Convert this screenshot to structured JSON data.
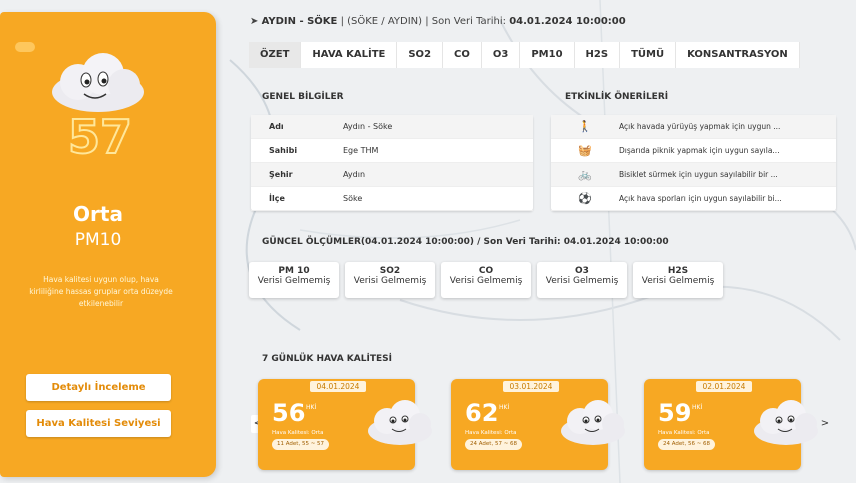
{
  "header": {
    "location": "AYDIN - SÖKE",
    "sub": "(SÖKE / AYDIN)",
    "last_label": "Son Veri Tarihi:",
    "last_value": "04.01.2024 10:00:00"
  },
  "tabs": [
    "ÖZET",
    "HAVA KALİTE",
    "SO2",
    "CO",
    "O3",
    "PM10",
    "H2S",
    "TÜMÜ",
    "KONSANTRASYON"
  ],
  "left": {
    "aqi": "57",
    "category": "Orta",
    "pollutant": "PM10",
    "description": "Hava kalitesi uygun olup, hava kirliliğine hassas gruplar orta düzeyde etkilenebilir",
    "btn_detail": "Detaylı İnceleme",
    "btn_level": "Hava Kalitesi Seviyesi",
    "accent": "#f7a823"
  },
  "general": {
    "title": "GENEL BİLGİLER",
    "rows": [
      {
        "k": "Adı",
        "v": "Aydın - Söke"
      },
      {
        "k": "Sahibi",
        "v": "Ege THM"
      },
      {
        "k": "Şehir",
        "v": "Aydın"
      },
      {
        "k": "İlçe",
        "v": "Söke"
      }
    ]
  },
  "activities": {
    "title": "ETKİNLİK ÖNERİLERİ",
    "rows": [
      {
        "icon": "walk-icon",
        "glyph": "🚶",
        "t": "Açık havada yürüyüş yapmak için uygun ..."
      },
      {
        "icon": "picnic-icon",
        "glyph": "🧺",
        "t": "Dışarıda piknik yapmak için uygun sayıla..."
      },
      {
        "icon": "bicycle-icon",
        "glyph": "🚲",
        "t": "Bisiklet sürmek için uygun sayılabilir bir ..."
      },
      {
        "icon": "ball-icon",
        "glyph": "⚽",
        "t": "Açık hava sporları için uygun sayılabilir bi..."
      }
    ]
  },
  "current": {
    "title": "GÜNCEL ÖLÇÜMLER(04.01.2024 10:00:00) / Son Veri Tarihi: 04.01.2024 10:00:00",
    "cards": [
      {
        "n": "PM 10",
        "s": "Verisi Gelmemiş"
      },
      {
        "n": "SO2",
        "s": "Verisi Gelmemiş"
      },
      {
        "n": "CO",
        "s": "Verisi Gelmemiş"
      },
      {
        "n": "O3",
        "s": "Verisi Gelmemiş"
      },
      {
        "n": "H2S",
        "s": "Verisi Gelmemiş"
      }
    ]
  },
  "week": {
    "title": "7 GÜNLÜK HAVA KALİTESİ",
    "days": [
      {
        "date": "04.01.2024",
        "val": "56",
        "sub": "HKİ",
        "lbl": "Hava Kalitesi: Orta",
        "cnt": "11 Adet, 55 ~ 57"
      },
      {
        "date": "03.01.2024",
        "val": "62",
        "sub": "HKİ",
        "lbl": "Hava Kalitesi: Orta",
        "cnt": "24 Adet, 57 ~ 68"
      },
      {
        "date": "02.01.2024",
        "val": "59",
        "sub": "HKİ",
        "lbl": "Hava Kalitesi: Orta",
        "cnt": "24 Adet, 56 ~ 68"
      }
    ],
    "prev": "<",
    "next": ">"
  }
}
